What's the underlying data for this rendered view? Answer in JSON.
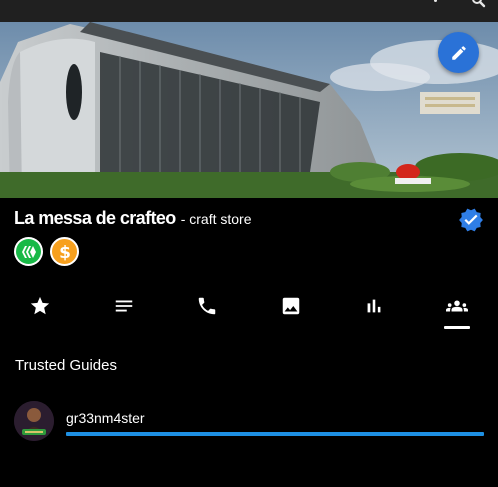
{
  "place": {
    "name": "La messa de crafteo",
    "category": "- craft store",
    "verified": true
  },
  "badges": [
    {
      "icon": "hive-icon",
      "color": "#18b947"
    },
    {
      "icon": "dollar-icon",
      "color": "#f7a01e"
    }
  ],
  "tabs": [
    {
      "icon": "star-icon"
    },
    {
      "icon": "notes-icon"
    },
    {
      "icon": "phone-icon"
    },
    {
      "icon": "image-icon"
    },
    {
      "icon": "bar-chart-icon"
    },
    {
      "icon": "group-icon",
      "active": true
    }
  ],
  "guides": {
    "title": "Trusted Guides",
    "items": [
      {
        "name": "gr33nm4ster",
        "progress_fraction": 1.0
      }
    ]
  },
  "colors": {
    "accent": "#1e90e3",
    "fab": "#2a72d7",
    "background": "#000000"
  }
}
